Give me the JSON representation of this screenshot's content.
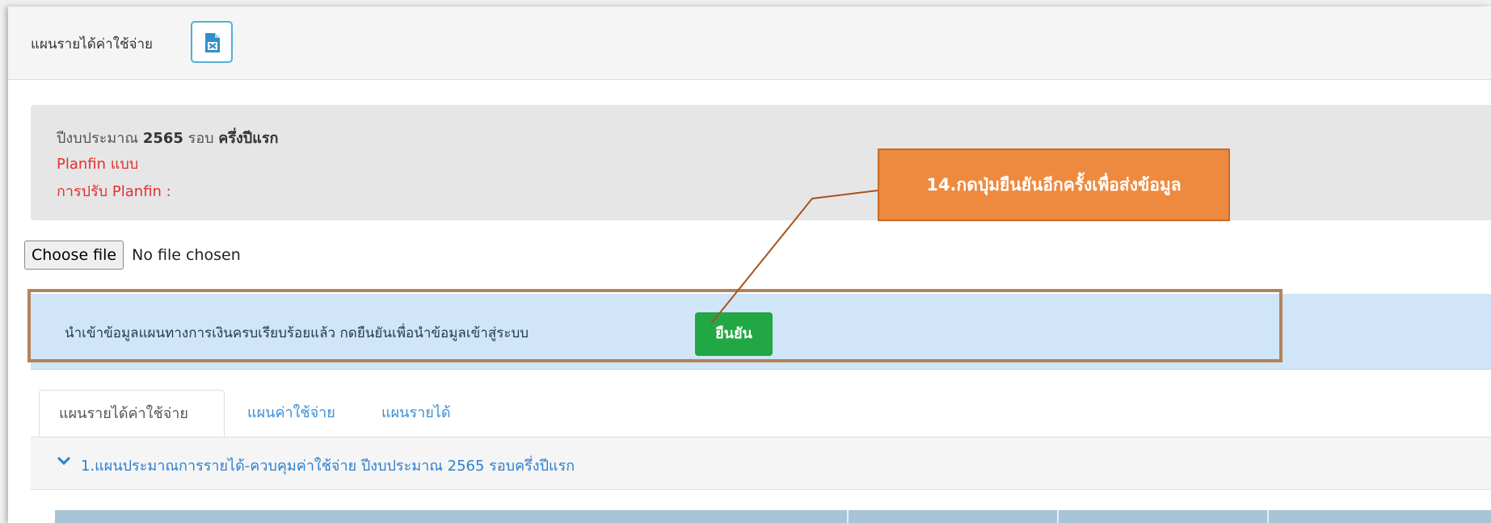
{
  "header": {
    "title": "แผนรายได้ค่าใช้จ่าย",
    "excel_icon": "excel-export-icon"
  },
  "info": {
    "year_label": "ปีงบประมาณ",
    "year_value": "2565",
    "round_label": "รอบ",
    "round_value": "ครึ่งปีแรก",
    "planfin_type": "Planfin แบบ",
    "planfin_adjust": "การปรับ Planfin :"
  },
  "file_input": {
    "button_label": "Choose file",
    "status": "No file chosen"
  },
  "alert": {
    "message": "นำเข้าข้อมูลแผนทางการเงินครบเรียบร้อยแล้ว กดยืนยันเพื่อนำข้อมูลเข้าสู่ระบบ",
    "confirm_label": "ยืนยัน"
  },
  "callout": {
    "text": "14.กดปุ่มยืนยันอีกครั้งเพื่อส่งข้อมูล",
    "color": "#ee8a3f"
  },
  "tabs": [
    {
      "label": "แผนรายได้ค่าใช้จ่าย",
      "active": true
    },
    {
      "label": "แผนค่าใช้จ่าย",
      "active": false
    },
    {
      "label": "แผนรายได้",
      "active": false
    }
  ],
  "section": {
    "title": "1.แผนประมาณการรายได้-ควบคุมค่าใช้จ่าย  ปีงบประมาณ 2565 รอบครึ่งปีแรก",
    "icon": "chevron-down-icon"
  },
  "colors": {
    "confirm_green": "#21a744",
    "link_blue": "#3a8fd6",
    "alert_bg": "#d0e5f8",
    "warning_red": "#e03131"
  }
}
